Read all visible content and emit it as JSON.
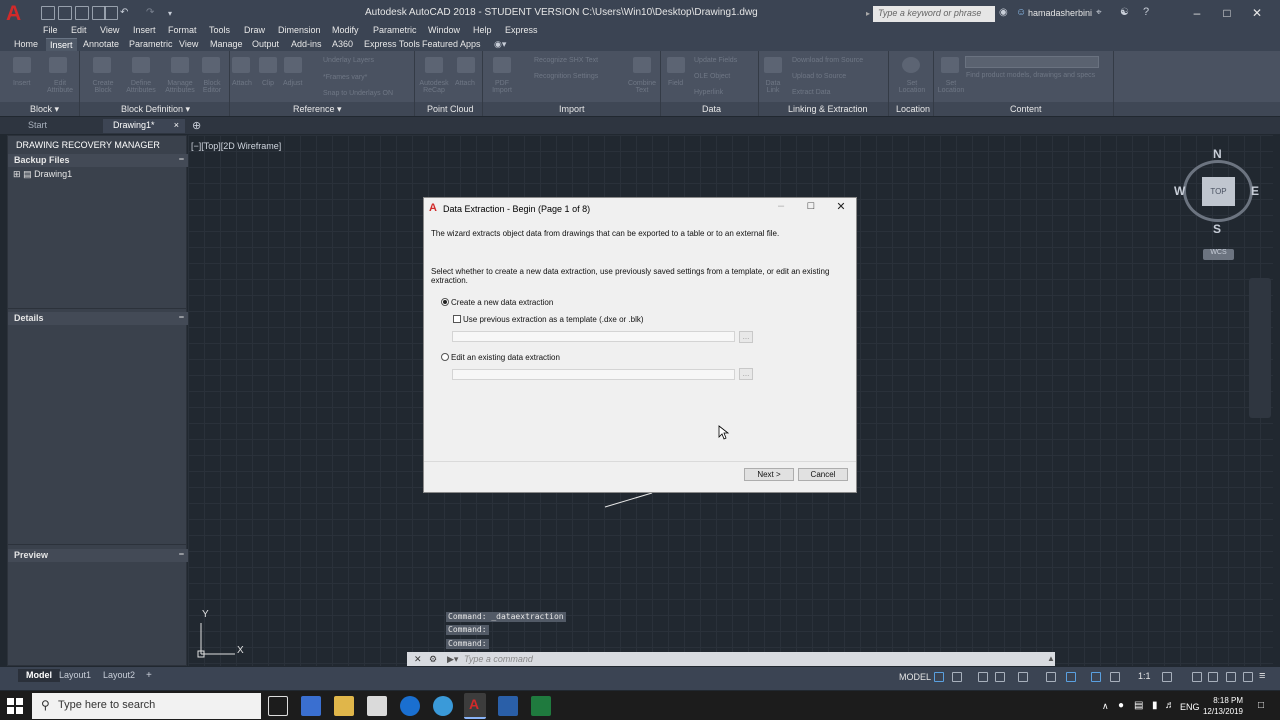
{
  "titlebar": {
    "title": "Autodesk AutoCAD 2018 - STUDENT VERSION    C:\\Users\\Win10\\Desktop\\Drawing1.dwg",
    "search_placeholder": "Type a keyword or phrase",
    "user": "hamadasherbini"
  },
  "menu": [
    "File",
    "Edit",
    "View",
    "Insert",
    "Format",
    "Tools",
    "Draw",
    "Dimension",
    "Modify",
    "Parametric",
    "Window",
    "Help",
    "Express"
  ],
  "ribbon_tabs": [
    "Home",
    "Insert",
    "Annotate",
    "Parametric",
    "View",
    "Manage",
    "Output",
    "Add-ins",
    "A360",
    "Express Tools",
    "Featured Apps"
  ],
  "ribbon_active_tab": "Insert",
  "ribbon_panels": [
    "Block",
    "Block Definition",
    "Reference",
    "Point Cloud",
    "Import",
    "Data",
    "Linking & Extraction",
    "Location",
    "Content"
  ],
  "ribbon_buttons": {
    "block": [
      "Insert",
      "Edit Attribute"
    ],
    "block_def": [
      "Create Block",
      "Define Attributes",
      "Manage Attributes",
      "Block Editor"
    ],
    "reference": [
      "Attach",
      "Clip",
      "Adjust",
      "Underlay Layers",
      "*Frames vary*",
      "Snap to Underlays ON"
    ],
    "point_cloud": [
      "Autodesk ReCap",
      "Attach"
    ],
    "import": [
      "PDF Import",
      "Recognize SHX Text",
      "Recognition Settings",
      "Combine Text"
    ],
    "data": [
      "Field",
      "Update Fields",
      "OLE Object",
      "Hyperlink"
    ],
    "linking": [
      "Data Link",
      "Download from Source",
      "Upload to Source",
      "Extract Data"
    ],
    "location": [
      "Set Location"
    ],
    "content": [
      "Design Center",
      "Find product models, drawings and specs"
    ]
  },
  "doc_tabs": [
    "Start",
    "Drawing1*"
  ],
  "palette": {
    "title": "DRAWING RECOVERY MANAGER",
    "backup_files": "Backup Files",
    "tree_item": "Drawing1",
    "details": "Details",
    "preview": "Preview"
  },
  "viewport_label": "[−][Top][2D Wireframe]",
  "viewcube": {
    "n": "N",
    "s": "S",
    "e": "E",
    "w": "W",
    "top": "TOP",
    "wcs": "WCS"
  },
  "dialog": {
    "title": "Data Extraction - Begin (Page 1 of 8)",
    "intro": "The wizard extracts object data from drawings that can be exported to a table or to an external file.",
    "instruction": "Select whether to create a new data extraction, use previously saved settings from a template, or edit an existing extraction.",
    "option_new": "Create a new data extraction",
    "option_template": "Use previous extraction as a template (.dxe or .blk)",
    "option_edit": "Edit an existing data extraction",
    "browse": "...",
    "next": "Next >",
    "cancel": "Cancel"
  },
  "command": {
    "history": [
      "Command: _dataextraction",
      "Command:",
      "Command:"
    ],
    "placeholder": "Type a command"
  },
  "axes": {
    "x": "X",
    "y": "Y"
  },
  "layout_tabs": [
    "Model",
    "Layout1",
    "Layout2"
  ],
  "statusbar": {
    "model": "MODEL",
    "scale": "1:1"
  },
  "taskbar": {
    "search": "Type here to search",
    "lang": "ENG",
    "time": "8:18 PM",
    "date": "12/13/2019"
  },
  "colors": {
    "accent_red": "#d12a2a",
    "ribbon_bg": "#4a5261",
    "canvas_bg": "#212830"
  }
}
